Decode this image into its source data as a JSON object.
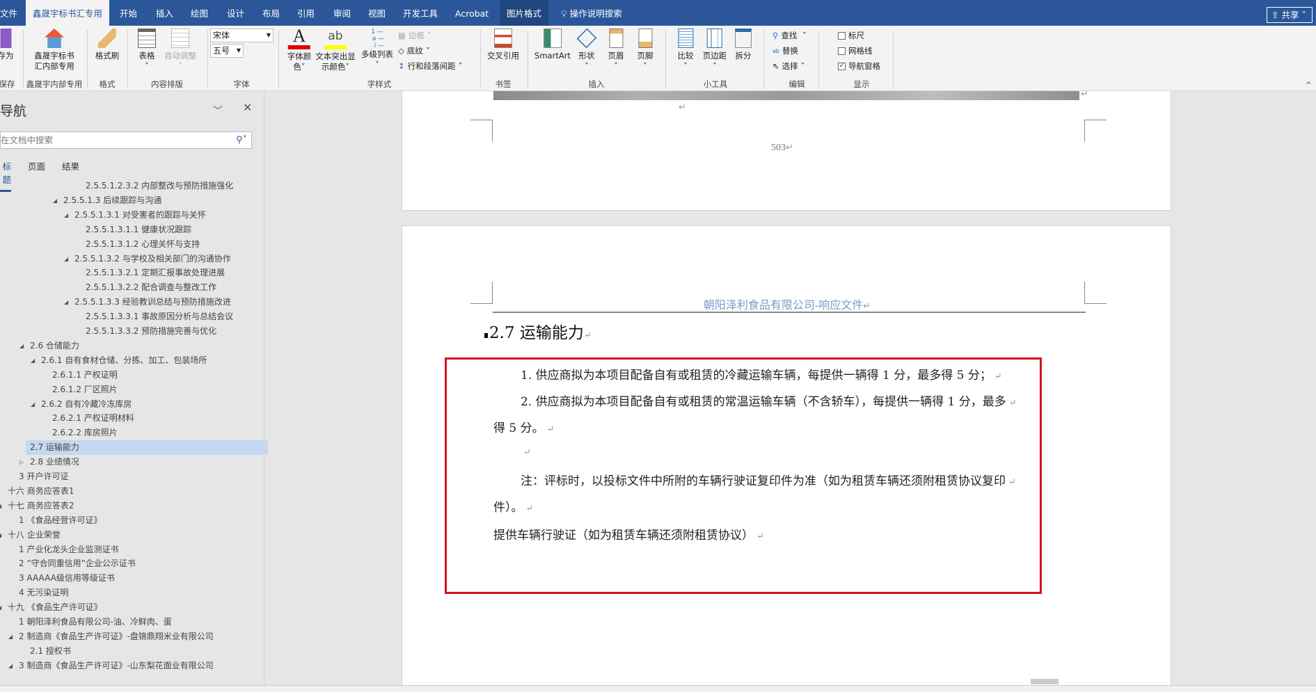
{
  "tabs": [
    "文件",
    "鑫晟宇标书汇专用",
    "开始",
    "插入",
    "绘图",
    "设计",
    "布局",
    "引用",
    "审阅",
    "视图",
    "开发工具",
    "Acrobat",
    "图片格式"
  ],
  "tell_me": "操作说明搜索",
  "share": "共享",
  "ribbon": {
    "save_as": "存为",
    "save_group": "保存",
    "xsy_btn": [
      "鑫晟宇标书",
      "汇内部专用"
    ],
    "xsy_group": "鑫晟宇内部专用",
    "format_painter": "格式刷",
    "format_group": "格式",
    "table": "表格",
    "auto_fit": "自动调整",
    "layout_group": "内容排版",
    "font_name": "宋体",
    "font_size": "五号",
    "font_group": "字体",
    "font_color": [
      "字体颜",
      "色"
    ],
    "highlight": [
      "文本突出显",
      "示颜色"
    ],
    "multilevel": "多级列表",
    "border": "边框",
    "shading": "底纹",
    "spacing": "行和段落间距",
    "style_group": "字样式",
    "cross_ref": "交叉引用",
    "bookmark_group": "书签",
    "smartart": "SmartArt",
    "shapes": "形状",
    "header": "页眉",
    "footer": "页脚",
    "insert_group": "插入",
    "compare": "比较",
    "margins": "页边距",
    "split": "拆分",
    "tools_group": "小工具",
    "find": "查找",
    "replace": "替换",
    "select": "选择",
    "edit_group": "编辑",
    "ruler": "标尺",
    "gridlines": "网格线",
    "nav_pane": "导航窗格",
    "show_group": "显示",
    "ruler_checked": false,
    "gridlines_checked": false,
    "nav_pane_checked": true
  },
  "nav": {
    "title": "导航",
    "search_placeholder": "在文档中搜索",
    "tabs": [
      "标题",
      "页面",
      "结果"
    ],
    "items": [
      {
        "label": "2.5.5.1.2.3.2 内部整改与预防措施强化",
        "depth": 7,
        "state": "none"
      },
      {
        "label": "2.5.5.1.3 后续跟踪与沟通",
        "depth": 5,
        "state": "expanded"
      },
      {
        "label": "2.5.5.1.3.1 对受害者的跟踪与关怀",
        "depth": 6,
        "state": "expanded"
      },
      {
        "label": "2.5.5.1.3.1.1 健康状况跟踪",
        "depth": 7,
        "state": "none"
      },
      {
        "label": "2.5.5.1.3.1.2 心理关怀与支持",
        "depth": 7,
        "state": "none"
      },
      {
        "label": "2.5.5.1.3.2 与学校及相关部门的沟通协作",
        "depth": 6,
        "state": "expanded"
      },
      {
        "label": "2.5.5.1.3.2.1 定期汇报事故处理进展",
        "depth": 7,
        "state": "none"
      },
      {
        "label": "2.5.5.1.3.2.2 配合调查与整改工作",
        "depth": 7,
        "state": "none"
      },
      {
        "label": "2.5.5.1.3.3 经验教训总结与预防措施改进",
        "depth": 6,
        "state": "expanded"
      },
      {
        "label": "2.5.5.1.3.3.1 事故原因分析与总结会议",
        "depth": 7,
        "state": "none"
      },
      {
        "label": "2.5.5.1.3.3.2 预防措施完善与优化",
        "depth": 7,
        "state": "none"
      },
      {
        "label": "2.6 仓储能力",
        "depth": 2,
        "state": "expanded"
      },
      {
        "label": "2.6.1 自有食材仓储、分拣、加工、包装场所",
        "depth": 3,
        "state": "expanded"
      },
      {
        "label": "2.6.1.1 产权证明",
        "depth": 4,
        "state": "none"
      },
      {
        "label": "2.6.1.2 厂区照片",
        "depth": 4,
        "state": "none"
      },
      {
        "label": "2.6.2 自有冷藏冷冻库房",
        "depth": 3,
        "state": "expanded"
      },
      {
        "label": "2.6.2.1 产权证明材料",
        "depth": 4,
        "state": "none"
      },
      {
        "label": "2.6.2.2 库房照片",
        "depth": 4,
        "state": "none"
      },
      {
        "label": "2.7 运输能力",
        "depth": 2,
        "state": "none",
        "selected": true
      },
      {
        "label": "2.8 业绩情况",
        "depth": 2,
        "state": "collapsed"
      },
      {
        "label": "3 开户许可证",
        "depth": 1,
        "state": "none"
      },
      {
        "label": "十六 商务应答表1",
        "depth": 0,
        "state": "none"
      },
      {
        "label": "十七 商务应答表2",
        "depth": 0,
        "state": "expanded"
      },
      {
        "label": "1 《食品经营许可证》",
        "depth": 1,
        "state": "none"
      },
      {
        "label": "十八 企业荣誉",
        "depth": 0,
        "state": "expanded"
      },
      {
        "label": "1 产业化龙头企业监测证书",
        "depth": 1,
        "state": "none"
      },
      {
        "label": "2 “守合同重信用”企业公示证书",
        "depth": 1,
        "state": "none"
      },
      {
        "label": "3 AAAAA级信用等级证书",
        "depth": 1,
        "state": "none"
      },
      {
        "label": "4 无污染证明",
        "depth": 1,
        "state": "none"
      },
      {
        "label": "十九 《食品生产许可证》",
        "depth": 0,
        "state": "expanded"
      },
      {
        "label": "1 朝阳泽利食品有限公司-油、冷鲜肉、蛋",
        "depth": 1,
        "state": "none"
      },
      {
        "label": "2 制造商《食品生产许可证》-盘锦鼎翔米业有限公司",
        "depth": 1,
        "state": "expanded"
      },
      {
        "label": "2.1 授权书",
        "depth": 2,
        "state": "none"
      },
      {
        "label": "3 制造商《食品生产许可证》-山东梨花面业有限公司",
        "depth": 1,
        "state": "expanded"
      }
    ]
  },
  "doc": {
    "page_number": "503",
    "header": "朝阳泽利食品有限公司-响应文件",
    "heading": "2.7 运输能力",
    "paragraphs": [
      "1. 供应商拟为本项目配备自有或租赁的冷藏运输车辆，每提供一辆得 1 分，最多得 5 分；",
      "2. 供应商拟为本项目配备自有或租赁的常温运输车辆（不含轿车），每提供一辆得 1 分，最多",
      "得 5 分。",
      "",
      "注：评标时，以投标文件中所附的车辆行驶证复印件为准（如为租赁车辆还须附租赁协议复印",
      "件）。",
      "提供车辆行驶证（如为租赁车辆还须附租赁协议）"
    ],
    "para_mark": "↵",
    "highlight_color": "#d0131e"
  },
  "colors": {
    "title_bar": "#2b579a",
    "selected_nav": "#c5d7f1"
  }
}
